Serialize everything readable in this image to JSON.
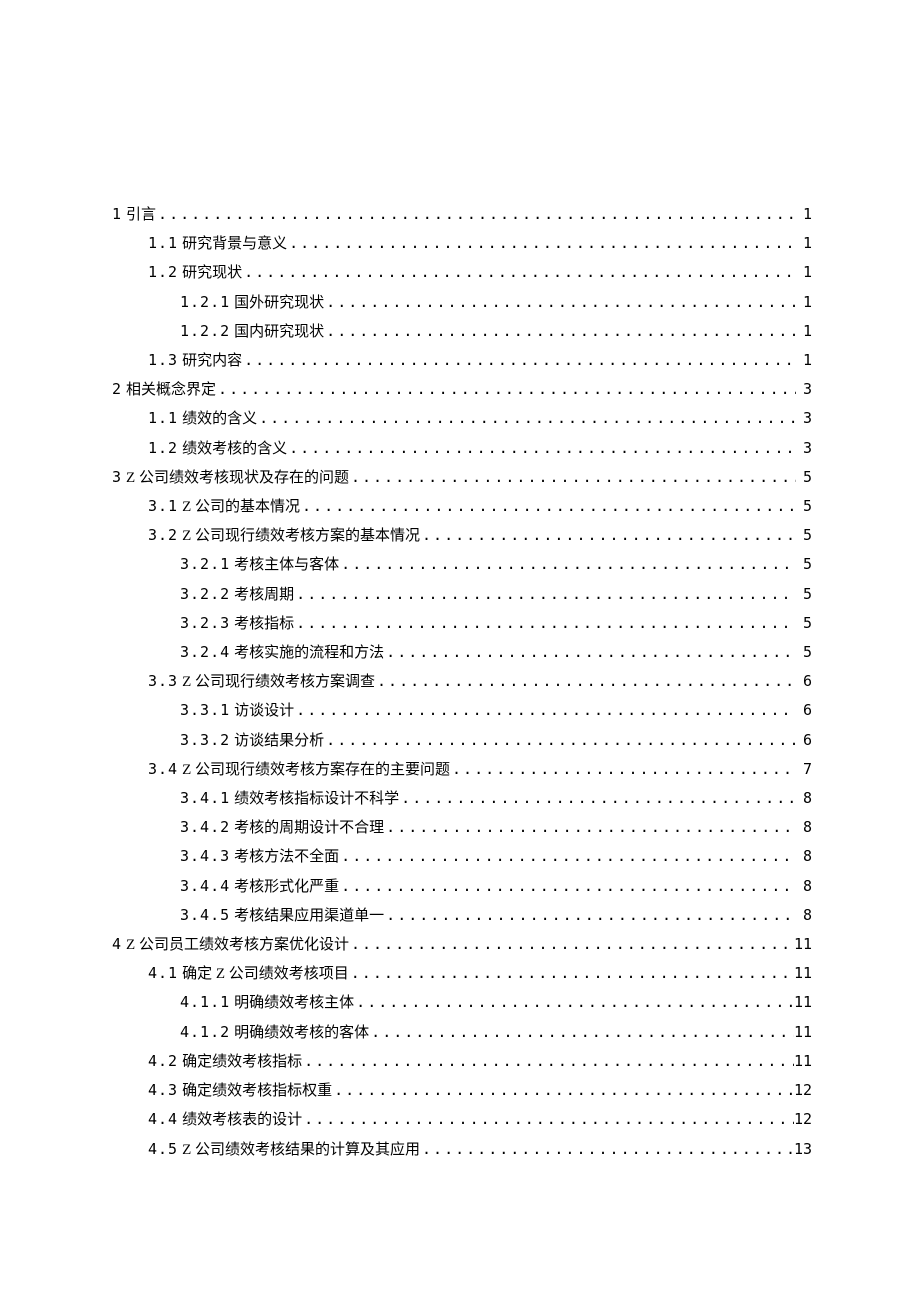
{
  "toc": [
    {
      "indent": 0,
      "num": "1",
      "title": "引言",
      "page": "1"
    },
    {
      "indent": 1,
      "num": "1.1",
      "title": "研究背景与意义",
      "page": "1"
    },
    {
      "indent": 1,
      "num": "1.2",
      "title": "研究现状",
      "page": "1"
    },
    {
      "indent": 2,
      "num": "1.2.1",
      "title": "国外研究现状",
      "page": "1"
    },
    {
      "indent": 2,
      "num": "1.2.2",
      "title": "国内研究现状",
      "page": "1"
    },
    {
      "indent": 1,
      "num": "1.3",
      "title": "研究内容",
      "page": "1"
    },
    {
      "indent": 0,
      "num": "2",
      "title": "相关概念界定",
      "page": "3"
    },
    {
      "indent": 1,
      "num": "1.1",
      "title": "绩效的含义",
      "page": "3"
    },
    {
      "indent": 1,
      "num": "1.2",
      "title": "绩效考核的含义",
      "page": "3"
    },
    {
      "indent": 0,
      "num": "3",
      "title": " Z 公司绩效考核现状及存在的问题",
      "page": "5"
    },
    {
      "indent": 1,
      "num": "3.1",
      "title": "Z 公司的基本情况",
      "page": "5"
    },
    {
      "indent": 1,
      "num": "3.2",
      "title": "Z 公司现行绩效考核方案的基本情况",
      "page": "5"
    },
    {
      "indent": 2,
      "num": "3.2.1",
      "title": "考核主体与客体",
      "page": "5"
    },
    {
      "indent": 2,
      "num": "3.2.2",
      "title": "考核周期",
      "page": "5"
    },
    {
      "indent": 2,
      "num": "3.2.3",
      "title": "考核指标",
      "page": "5"
    },
    {
      "indent": 2,
      "num": "3.2.4",
      "title": "考核实施的流程和方法",
      "page": "5"
    },
    {
      "indent": 1,
      "num": "3.3",
      "title": "Z 公司现行绩效考核方案调查",
      "page": "6"
    },
    {
      "indent": 2,
      "num": "3.3.1",
      "title": "访谈设计",
      "page": "6"
    },
    {
      "indent": 2,
      "num": "3.3.2",
      "title": "访谈结果分析",
      "page": "6"
    },
    {
      "indent": 1,
      "num": "3.4",
      "title": "Z 公司现行绩效考核方案存在的主要问题",
      "page": "7"
    },
    {
      "indent": 2,
      "num": "3.4.1",
      "title": "绩效考核指标设计不科学",
      "page": "8"
    },
    {
      "indent": 2,
      "num": "3.4.2",
      "title": "考核的周期设计不合理",
      "page": "8"
    },
    {
      "indent": 2,
      "num": "3.4.3",
      "title": "考核方法不全面",
      "page": "8"
    },
    {
      "indent": 2,
      "num": "3.4.4",
      "title": "考核形式化严重",
      "page": "8"
    },
    {
      "indent": 2,
      "num": "3.4.5",
      "title": "考核结果应用渠道单一",
      "page": "8"
    },
    {
      "indent": 0,
      "num": "4",
      "title": " Z 公司员工绩效考核方案优化设计",
      "page": "11"
    },
    {
      "indent": 1,
      "num": "4.1",
      "title": "确定 Z 公司绩效考核项目",
      "page": "11"
    },
    {
      "indent": 2,
      "num": "4.1.1",
      "title": "明确绩效考核主体",
      "page": "11"
    },
    {
      "indent": 2,
      "num": "4.1.2",
      "title": "明确绩效考核的客体",
      "page": "11"
    },
    {
      "indent": 1,
      "num": "4.2",
      "title": "确定绩效考核指标",
      "page": "11"
    },
    {
      "indent": 1,
      "num": "4.3",
      "title": "确定绩效考核指标权重",
      "page": "12"
    },
    {
      "indent": 1,
      "num": "4.4",
      "title": "绩效考核表的设计",
      "page": "12"
    },
    {
      "indent": 1,
      "num": "4.5",
      "title": "Z 公司绩效考核结果的计算及其应用",
      "page": "13"
    }
  ]
}
